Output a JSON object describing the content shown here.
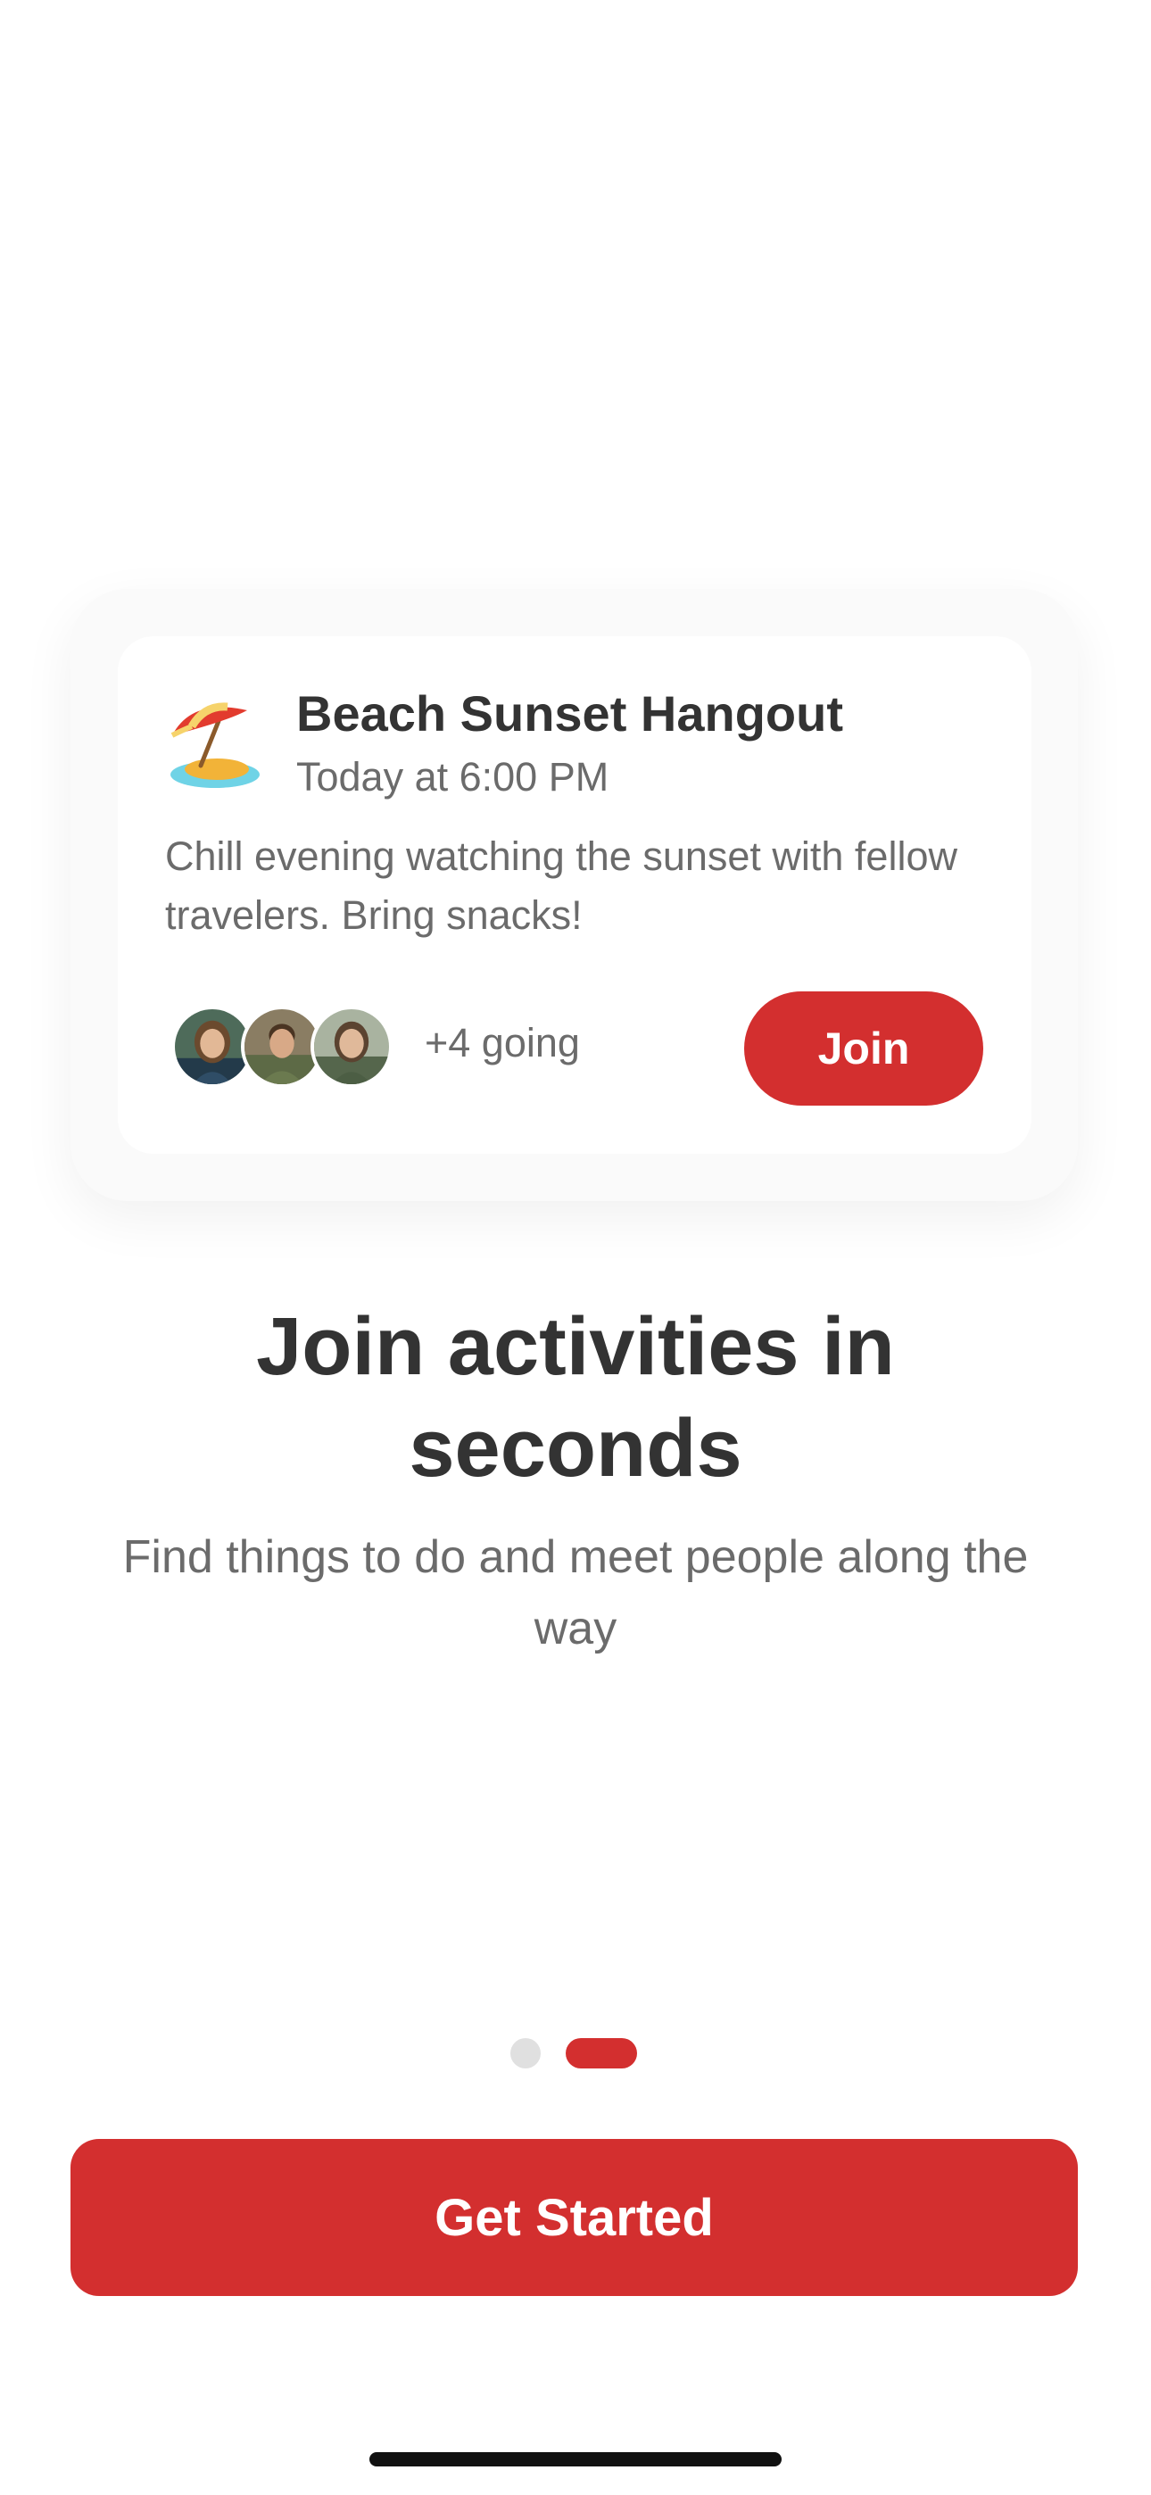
{
  "event_card": {
    "icon": "beach-umbrella-icon",
    "title": "Beach Sunset Hangout",
    "time": "Today at 6:00 PM",
    "description": "Chill evening watching the sunset with fellow travelers. Bring snacks!",
    "attendees": [
      {
        "name": "attendee-avatar-1"
      },
      {
        "name": "attendee-avatar-2"
      },
      {
        "name": "attendee-avatar-3"
      }
    ],
    "going_text": "+4 going",
    "join_label": "Join"
  },
  "onboarding": {
    "headline": "Join activities in seconds",
    "subtitle": "Find things to do and meet people along the way",
    "page_indicator": {
      "total": 2,
      "current": 2
    }
  },
  "cta": {
    "label": "Get Started"
  },
  "colors": {
    "accent": "#d32f2f",
    "text_primary": "#333333",
    "text_secondary": "#6b6b6b",
    "dot_inactive": "#e0e0e0"
  }
}
